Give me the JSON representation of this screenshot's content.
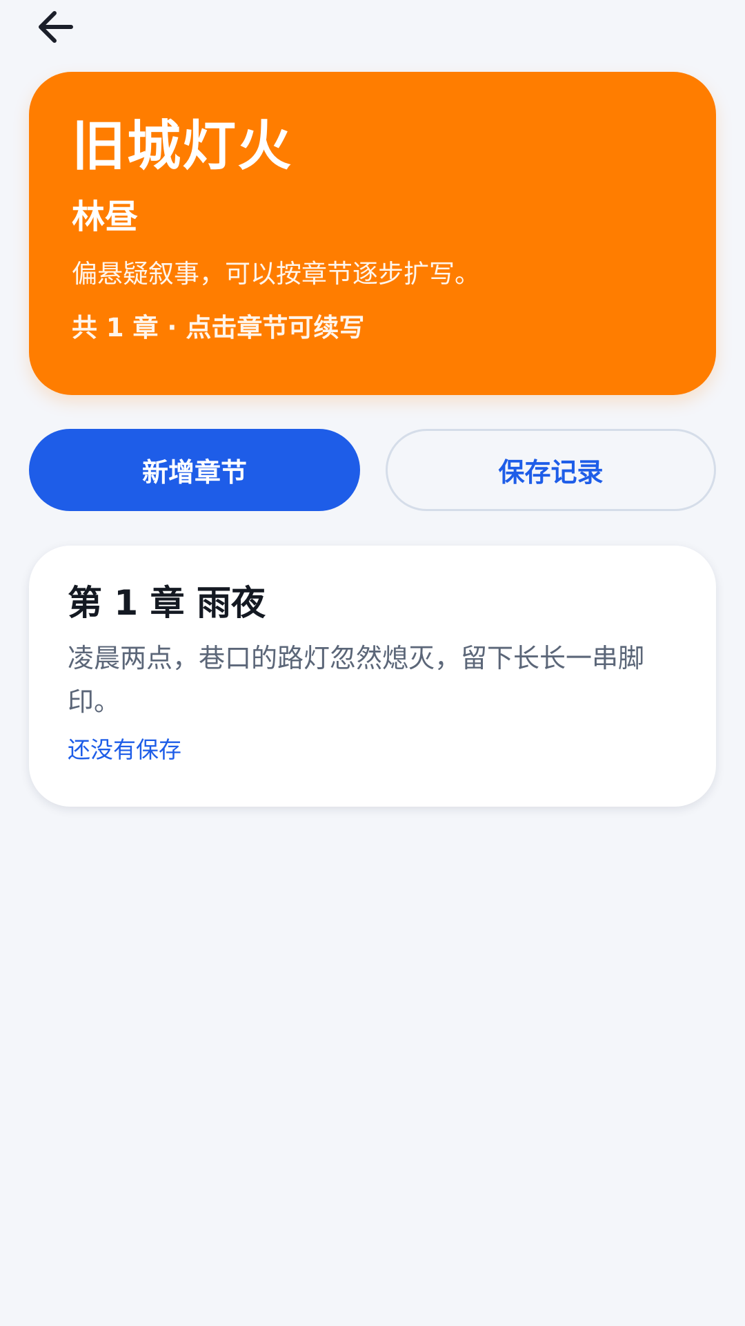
{
  "nav": {
    "back_icon": "arrow-left-icon"
  },
  "book": {
    "title": "旧城灯火",
    "author": "林昼",
    "description": "偏悬疑叙事，可以按章节逐步扩写。",
    "meta": "共 1 章 · 点击章节可续写"
  },
  "actions": {
    "add_chapter_label": "新增章节",
    "save_record_label": "保存记录"
  },
  "chapters": [
    {
      "title": "第 1 章 雨夜",
      "excerpt": "凌晨两点，巷口的路灯忽然熄灭，留下长长一串脚印。",
      "status": "还没有保存"
    }
  ],
  "colors": {
    "background": "#f4f6fa",
    "hero": "#ff7d00",
    "primary": "#1e5de8",
    "text_dark": "#141922",
    "text_muted": "#5b6678"
  }
}
